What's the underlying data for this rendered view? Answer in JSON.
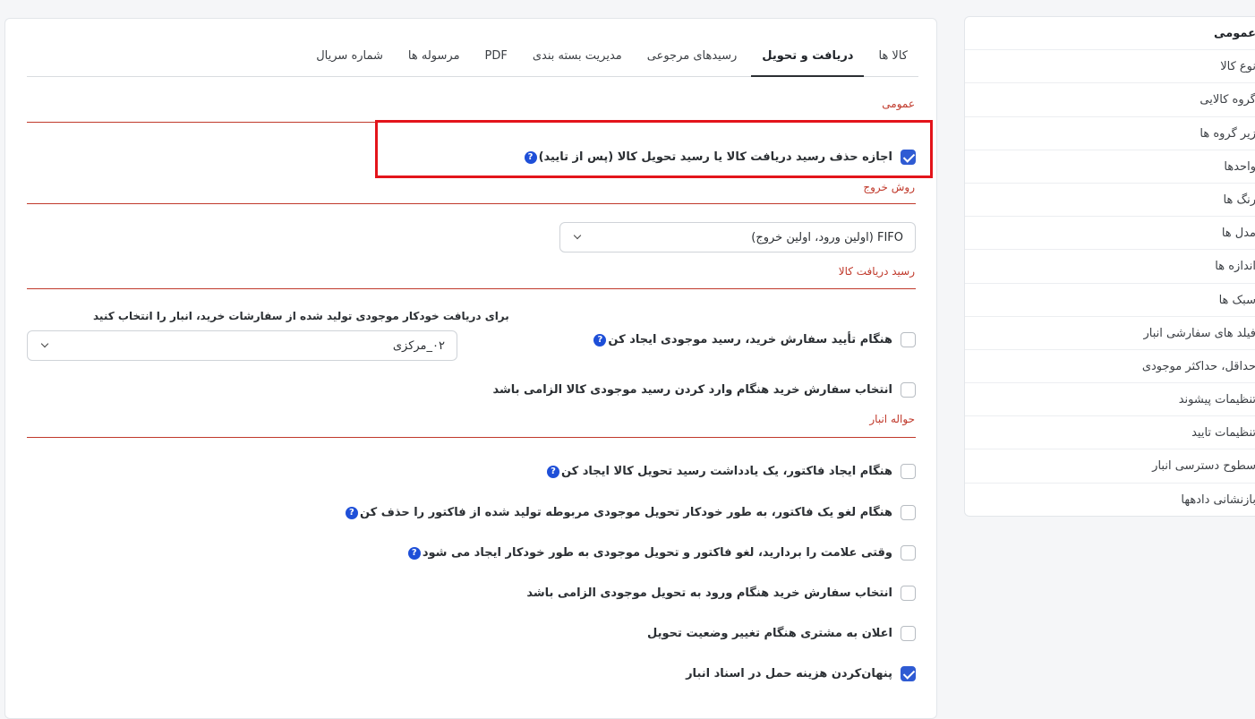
{
  "sidebar": {
    "items": [
      {
        "label": "عمومی"
      },
      {
        "label": "نوع کالا"
      },
      {
        "label": "گروه کالایی"
      },
      {
        "label": "زیر گروه ها"
      },
      {
        "label": "واحدها"
      },
      {
        "label": "رنگ ها"
      },
      {
        "label": "مدل ها"
      },
      {
        "label": "اندازه ها"
      },
      {
        "label": "سبک ها"
      },
      {
        "label": "فیلد های سفارشی انبار"
      },
      {
        "label": "حداقل، حداکثر موجودی"
      },
      {
        "label": "تنظیمات پیشوند"
      },
      {
        "label": "تنظیمات تایید"
      },
      {
        "label": "سطوح دسترسی انبار"
      },
      {
        "label": "بازنشانی دادهها"
      }
    ]
  },
  "tabs": [
    {
      "label": "کالا ها"
    },
    {
      "label": "دریافت و تحویل"
    },
    {
      "label": "رسیدهای مرجوعی"
    },
    {
      "label": "مدیریت بسته بندی"
    },
    {
      "label": "PDF"
    },
    {
      "label": "مرسوله ها"
    },
    {
      "label": "شماره سریال"
    }
  ],
  "sections": {
    "general": {
      "title": "عمومی",
      "allow_delete": {
        "label": "اجازه حذف رسید دریافت کالا یا رسید تحویل کالا (پس از تایید)",
        "checked": true
      }
    },
    "exit_method": {
      "title": "روش خروج",
      "select_value": "FIFO (اولین ورود، اولین خروج)"
    },
    "goods_receipt": {
      "title": "رسید دریافت کالا",
      "auto_receipt": {
        "label": "هنگام تأیید سفارش خرید، رسید موجودی ایجاد کن",
        "checked": false
      },
      "warehouse_note": "برای دریافت خودکار موجودی تولید شده از سفارشات خرید، انبار را انتخاب کنید",
      "warehouse_value": "۰۲_مرکزی",
      "require_po": {
        "label": "انتخاب سفارش خرید هنگام وارد کردن رسید موجودی کالا الزامی باشد",
        "checked": false
      }
    },
    "warehouse_transfer": {
      "title": "حواله انبار",
      "items": [
        {
          "label": "هنگام ایجاد فاکتور، یک یادداشت رسید تحویل کالا ایجاد کن",
          "checked": false,
          "help": true
        },
        {
          "label": "هنگام لغو یک فاکتور، به طور خودکار تحویل موجودی مربوطه تولید شده از فاکتور را حذف کن",
          "checked": false,
          "help": true
        },
        {
          "label": "وقتی علامت را بردارید، لغو فاکتور و تحویل موجودی به طور خودکار ایجاد می شود",
          "checked": false,
          "help": true
        },
        {
          "label": "انتخاب سفارش خرید هنگام ورود به تحویل موجودی الزامی باشد",
          "checked": false,
          "help": false
        },
        {
          "label": "اعلان به مشتری هنگام تغییر وضعیت تحویل",
          "checked": false,
          "help": false
        },
        {
          "label": "پنهان‌کردن هزینه حمل در اسناد انبار",
          "checked": true,
          "help": false
        }
      ]
    }
  },
  "help_glyph": "?",
  "colors": {
    "accent": "#2f5bd3",
    "section": "#c0392b",
    "highlight": "#e3141b"
  }
}
